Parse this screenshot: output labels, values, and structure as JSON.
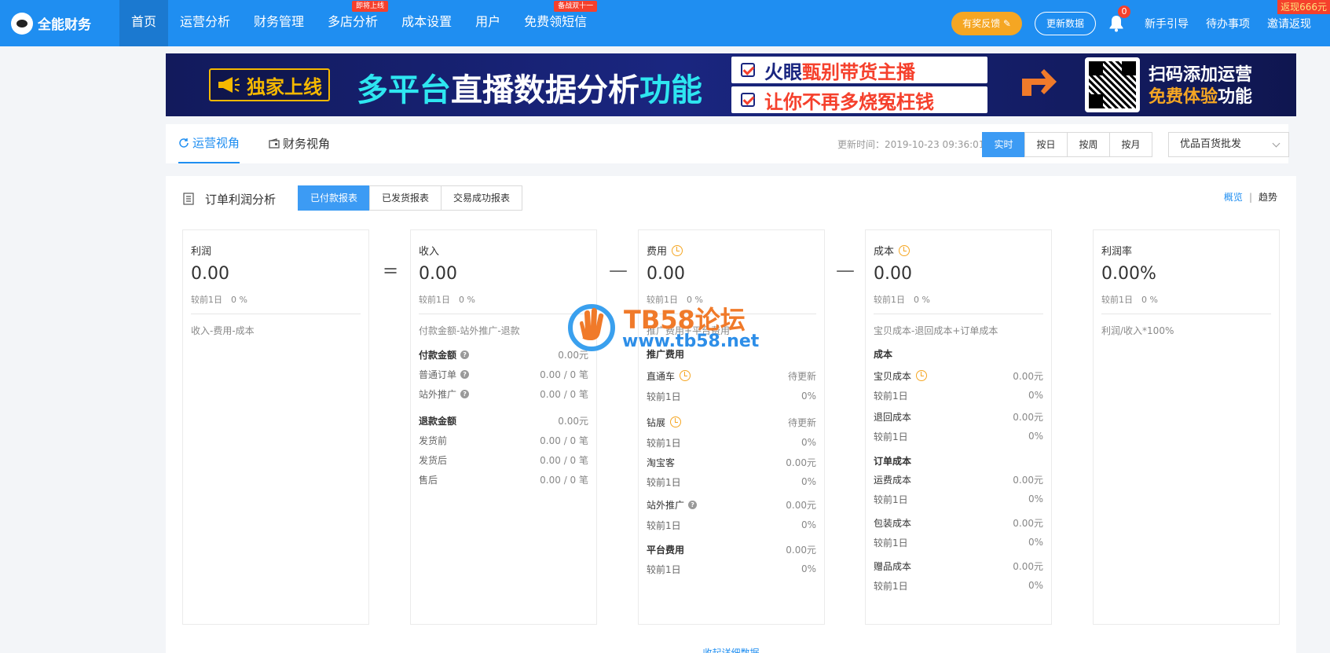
{
  "nav": {
    "logo": "全能财务",
    "items": [
      {
        "label": "首页",
        "tag": ""
      },
      {
        "label": "运营分析",
        "tag": ""
      },
      {
        "label": "财务管理",
        "tag": ""
      },
      {
        "label": "多店分析",
        "tag": "即将上线"
      },
      {
        "label": "成本设置",
        "tag": ""
      },
      {
        "label": "用户",
        "tag": ""
      },
      {
        "label": "免费领短信",
        "tag": "备战双十一"
      }
    ],
    "feedback": "有奖反馈",
    "update": "更新数据",
    "bell_count": "0",
    "guide": "新手引导",
    "todo": "待办事项",
    "invite": "邀请返现",
    "rebate": "返现666元"
  },
  "banner": {
    "exclusive": "独家上线",
    "title_a": "多平台",
    "title_b": "直播数据分析",
    "title_c": "功能",
    "line1_a": "火眼",
    "line1_b": "甄别带货主播",
    "line2": "让你不再多烧冤枉钱",
    "scan1": "扫码添加运营",
    "scan2_a": "免费体验",
    "scan2_b": "功能"
  },
  "viewbar": {
    "tab_ops": "运营视角",
    "tab_fin": "财务视角",
    "update_time": "更新时间：2019-10-23 09:36:01",
    "seg": [
      "实时",
      "按日",
      "按周",
      "按月"
    ],
    "shop": "优品百货批发"
  },
  "card": {
    "title": "订单利润分析",
    "report_tabs": [
      "已付款报表",
      "已发货报表",
      "交易成功报表"
    ],
    "overview": "概览",
    "trend": "趋势",
    "collapse": "收起详细数据"
  },
  "profit": {
    "label": "利润",
    "value": "0.00",
    "cmp": "较前1日　0 %",
    "formula": "收入-费用-成本"
  },
  "income": {
    "label": "收入",
    "value": "0.00",
    "cmp": "较前1日　0 %",
    "formula": "付款金额-站外推广-退款",
    "rows": [
      {
        "k": "付款金额",
        "v": "0.00元"
      },
      {
        "k": "普通订单",
        "v": "0.00 / 0 笔"
      },
      {
        "k": "站外推广",
        "v": "0.00 / 0 笔"
      },
      {
        "k": "退款金额",
        "v": "0.00元"
      },
      {
        "k": "发货前",
        "v": "0.00 / 0 笔"
      },
      {
        "k": "发货后",
        "v": "0.00 / 0 笔"
      },
      {
        "k": "售后",
        "v": "0.00 / 0 笔"
      }
    ]
  },
  "expense": {
    "label": "费用",
    "value": "0.00",
    "cmp": "较前1日　0 %",
    "formula": "推广费用+平台费用",
    "section": "推广费用",
    "rows": [
      {
        "k": "直通车",
        "v": "待更新"
      },
      {
        "k": "较前1日",
        "v": "0%"
      },
      {
        "k": "钻展",
        "v": "待更新"
      },
      {
        "k": "较前1日",
        "v": "0%"
      },
      {
        "k": "淘宝客",
        "v": "0.00元"
      },
      {
        "k": "较前1日",
        "v": "0%"
      },
      {
        "k": "站外推广",
        "v": "0.00元"
      },
      {
        "k": "较前1日",
        "v": "0%"
      },
      {
        "k": "平台费用",
        "v": "0.00元"
      },
      {
        "k": "较前1日",
        "v": "0%"
      }
    ]
  },
  "cost": {
    "label": "成本",
    "value": "0.00",
    "cmp": "较前1日　0 %",
    "formula": "宝贝成本-退回成本+订单成本",
    "section1": "成本",
    "section2": "订单成本",
    "rows": [
      {
        "k": "宝贝成本",
        "v": "0.00元"
      },
      {
        "k": "较前1日",
        "v": "0%"
      },
      {
        "k": "退回成本",
        "v": "0.00元"
      },
      {
        "k": "较前1日",
        "v": "0%"
      },
      {
        "k": "运费成本",
        "v": "0.00元"
      },
      {
        "k": "较前1日",
        "v": "0%"
      },
      {
        "k": "包装成本",
        "v": "0.00元"
      },
      {
        "k": "较前1日",
        "v": "0%"
      },
      {
        "k": "赠品成本",
        "v": "0.00元"
      },
      {
        "k": "较前1日",
        "v": "0%"
      }
    ]
  },
  "rate": {
    "label": "利润率",
    "value": "0.00%",
    "cmp": "较前1日　0 %",
    "formula": "利润/收入*100%"
  },
  "ops": {
    "eq": "=",
    "minus": "—"
  },
  "watermark": {
    "line1": "TB58论坛",
    "line2": "www.tb58.net"
  }
}
